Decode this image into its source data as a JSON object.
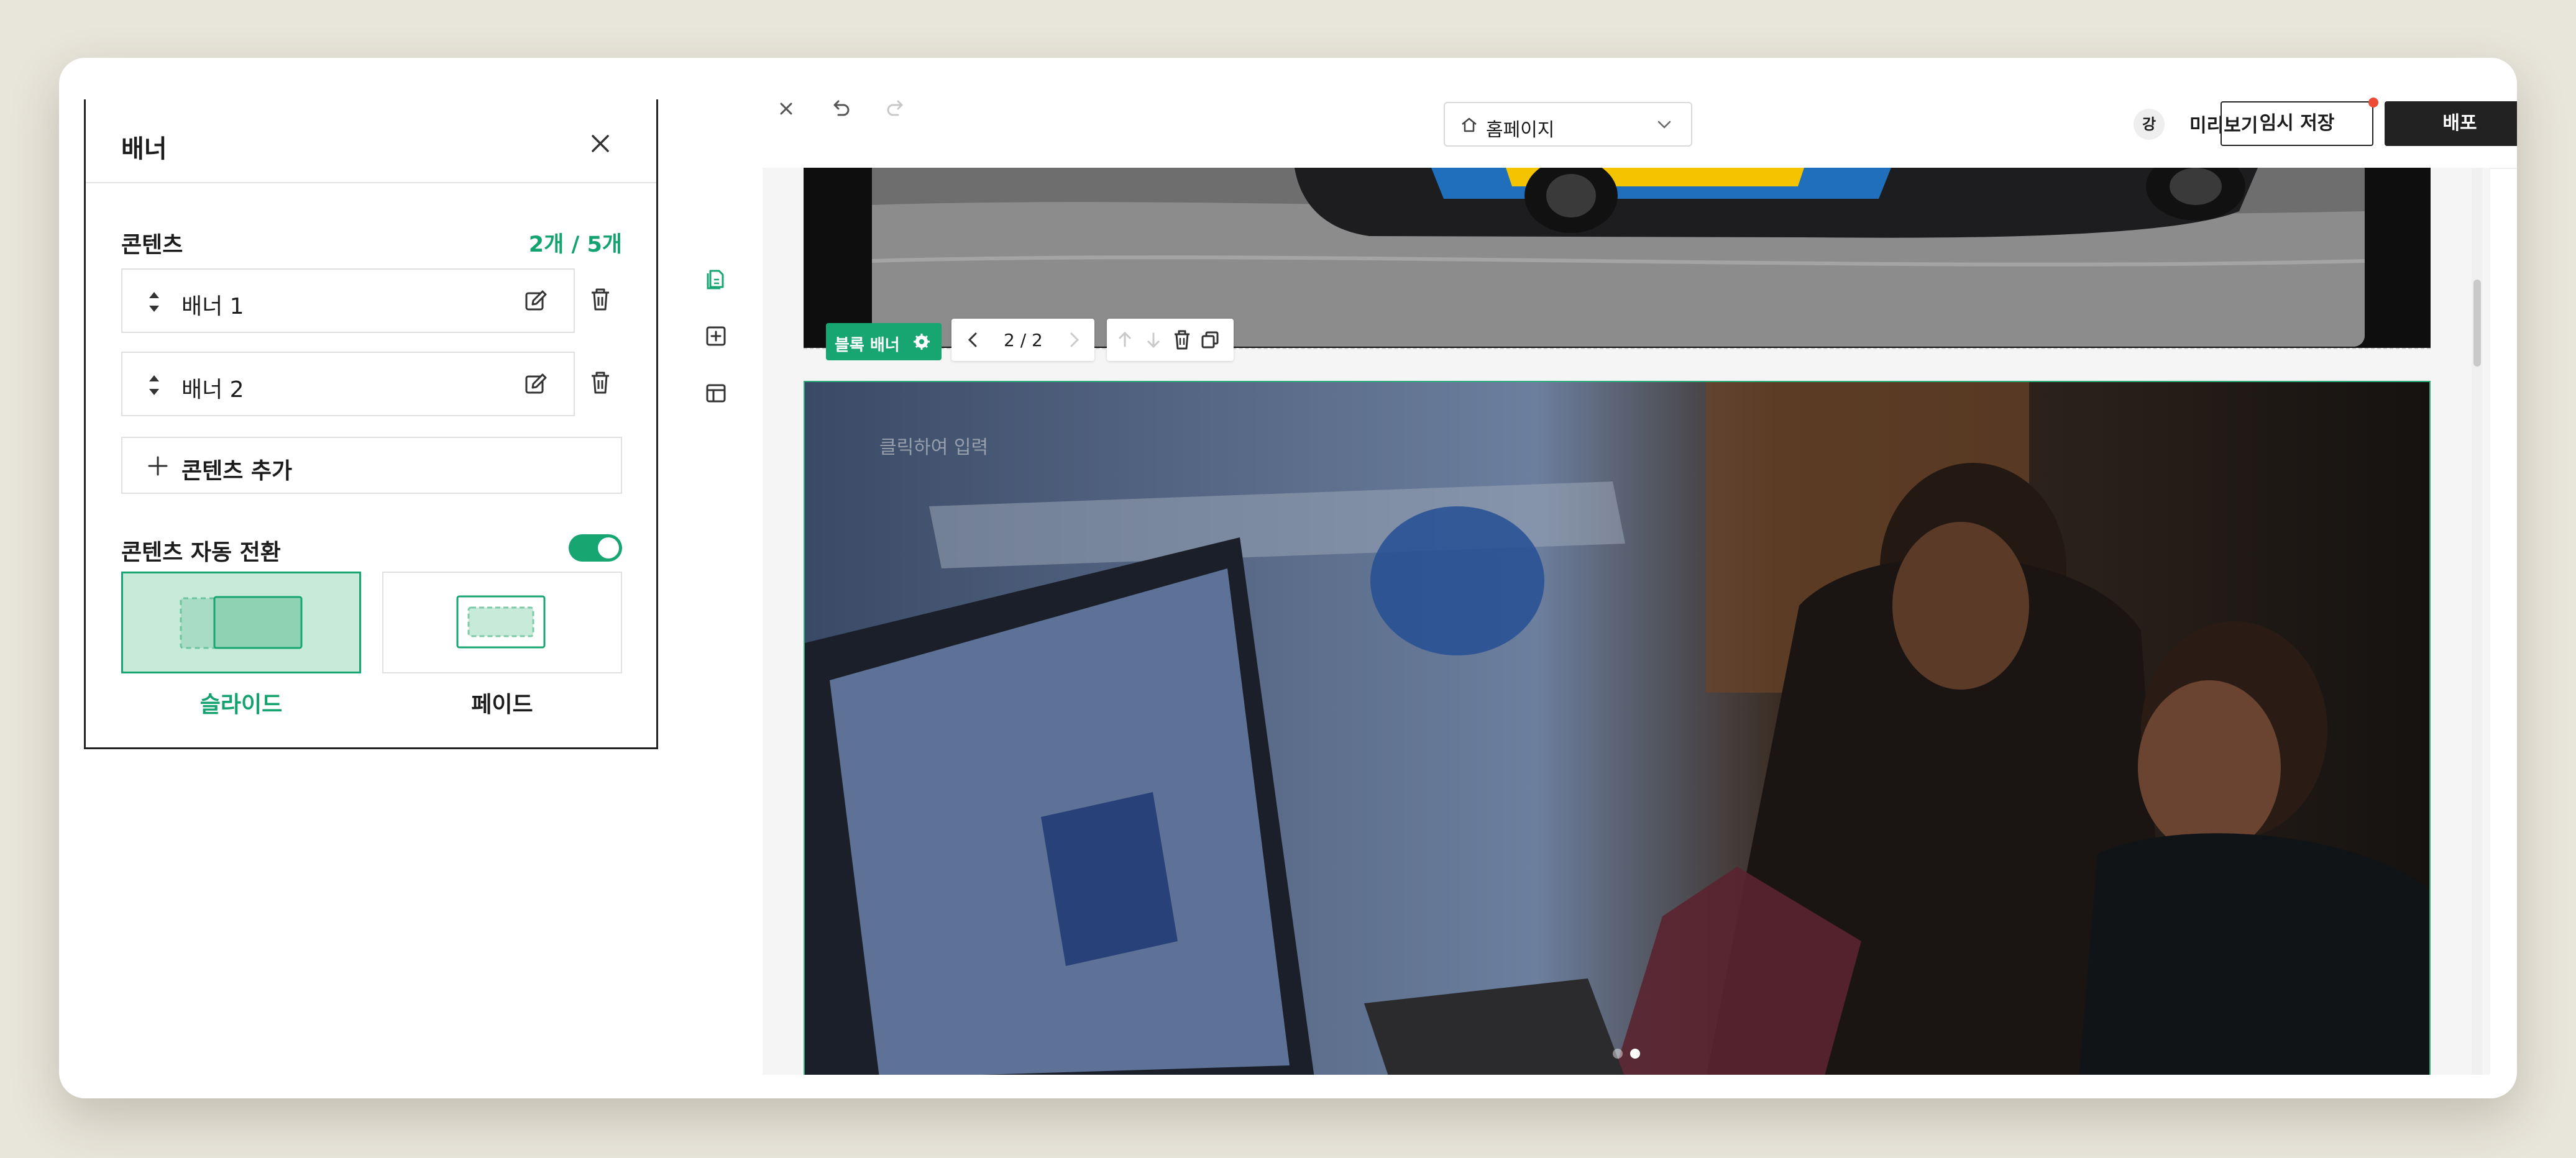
{
  "panel": {
    "title": "배너",
    "contents_title": "콘텐츠",
    "contents_count": "2개 / 5개",
    "items": [
      {
        "label": "배너 1"
      },
      {
        "label": "배너 2"
      }
    ],
    "add_label": "콘텐츠 추가",
    "auto_switch_label": "콘텐츠 자동 전환",
    "auto_switch_on": true,
    "transition_options": [
      {
        "label": "슬라이드",
        "selected": true
      },
      {
        "label": "페이드",
        "selected": false
      }
    ]
  },
  "topbar": {
    "page_select": "홈페이지",
    "avatar": "강",
    "preview": "미리보기",
    "draft_save": "임시 저장",
    "deploy": "배포"
  },
  "canvas": {
    "block_tag": "블록 배너",
    "pager": "2 / 2",
    "placeholder": "클릭하여 입력"
  },
  "colors": {
    "accent": "#17a572",
    "dark": "#222222",
    "notify": "#ee4b37"
  }
}
